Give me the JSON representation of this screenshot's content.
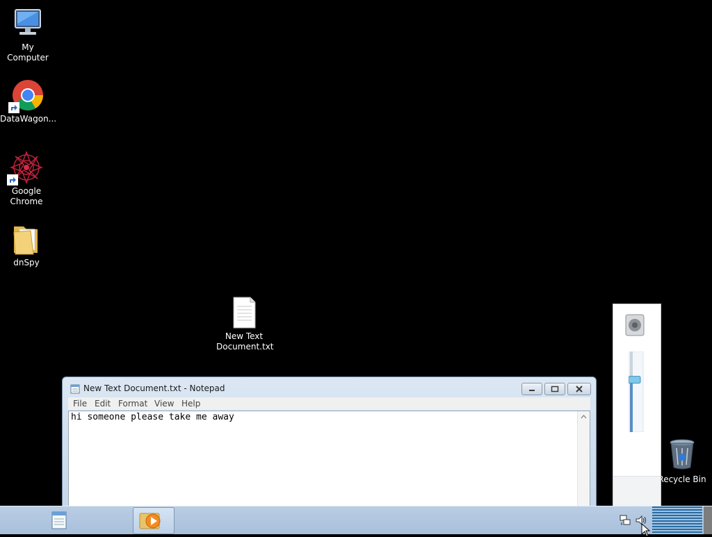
{
  "desktop": {
    "icons": [
      {
        "label": "My Computer"
      },
      {
        "label": "DataWagon..."
      },
      {
        "label": "Google Chrome"
      },
      {
        "label": "dnSpy"
      },
      {
        "label": "New Text Document.txt"
      },
      {
        "label": "Recycle Bin"
      }
    ]
  },
  "notepad": {
    "title": "New Text Document.txt - Notepad",
    "menu": [
      "File",
      "Edit",
      "Format",
      "View",
      "Help"
    ],
    "content": "hi someone please take me away"
  },
  "volume": {
    "level": 0.65
  },
  "taskbar": {
    "buttons": [
      {
        "icon": "notepad-icon",
        "active": false
      },
      {
        "icon": "media-player-icon",
        "active": true
      }
    ],
    "tray": [
      "network-icon",
      "speaker-icon"
    ]
  }
}
